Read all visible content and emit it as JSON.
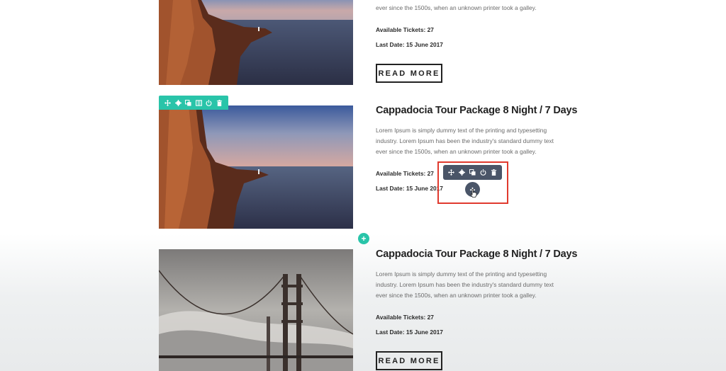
{
  "entries": [
    {
      "title": "",
      "description_tail": "ever since the 1500s, when an unknown printer took a galley.",
      "tickets": "Available Tickets: 27",
      "date": "Last Date: 15 June 2017",
      "read_more": "READ MORE",
      "image": "cliff-sea-photo"
    },
    {
      "title": "Cappadocia Tour Package 8 Night / 7 Days",
      "description": [
        "Lorem Ipsum is simply dummy text of the printing and typesetting",
        "industry. Lorem Ipsum has been the industry's standard dummy text",
        "ever since the 1500s, when an unknown printer took a galley."
      ],
      "tickets": "Available Tickets: 27",
      "date": "Last Date: 15 June 2017",
      "image": "cliff-sea-photo"
    },
    {
      "title": "Cappadocia Tour Package 8 Night / 7 Days",
      "description": [
        "Lorem Ipsum is simply dummy text of the printing and typesetting",
        "industry. Lorem Ipsum has been the industry's standard dummy text",
        "ever since the 1500s, when an unknown printer took a galley."
      ],
      "tickets": "Available Tickets: 27",
      "date": "Last Date: 15 June 2017",
      "read_more": "READ MORE",
      "image": "golden-gate-fog-photo"
    }
  ],
  "section_toolbar": {
    "icons": [
      "move-icon",
      "gear-icon",
      "duplicate-icon",
      "columns-icon",
      "power-icon",
      "trash-icon"
    ],
    "color": "#29c4a9"
  },
  "module_toolbar": {
    "icons": [
      "move-icon",
      "gear-icon",
      "duplicate-icon",
      "power-icon",
      "trash-icon"
    ],
    "color": "#4a5568"
  },
  "add_buttons": {
    "module_add": "+",
    "row_add": "+"
  },
  "highlight_color": "#e03a2e"
}
